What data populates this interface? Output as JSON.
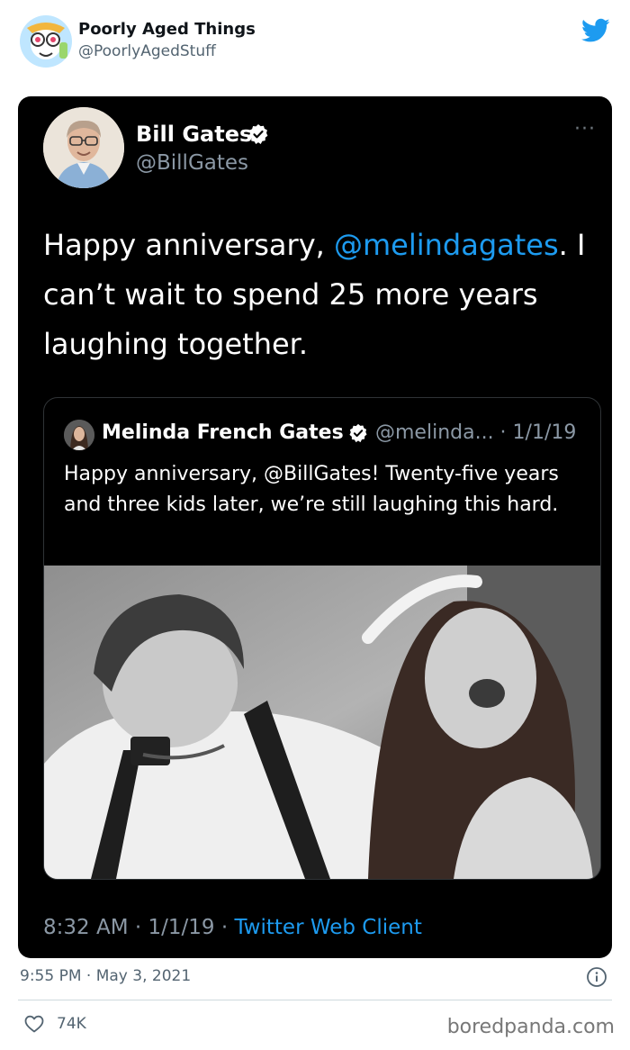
{
  "outer_tweet": {
    "account_name": "Poorly Aged Things",
    "account_handle": "@PoorlyAgedStuff",
    "posted_time": "9:55 PM · May 3, 2021",
    "likes": "74K"
  },
  "embedded_tweet": {
    "author_name": "Bill Gates",
    "author_handle": "@BillGates",
    "more_label": "···",
    "text_before": "Happy anniversary, ",
    "mention": "@melindagates",
    "text_after": ". I can’t wait to spend 25 more years laughing together.",
    "posted_time": "8:32 AM · 1/1/19 · ",
    "client": "Twitter Web Client"
  },
  "quoted_tweet": {
    "author_name": "Melinda French Gates",
    "author_handle": "@melinda... · 1/1/19",
    "text": "Happy anniversary, @BillGates! Twenty-five years and three kids later, we’re still laughing this hard."
  },
  "watermark": "boredpanda.com",
  "icons": {
    "brand": "twitter-bird-icon",
    "verified": "verified-badge-icon",
    "info": "info-icon",
    "like": "heart-icon"
  },
  "colors": {
    "accent": "#1d9bf0",
    "card_background": "#000000",
    "muted_text": "#536471"
  }
}
